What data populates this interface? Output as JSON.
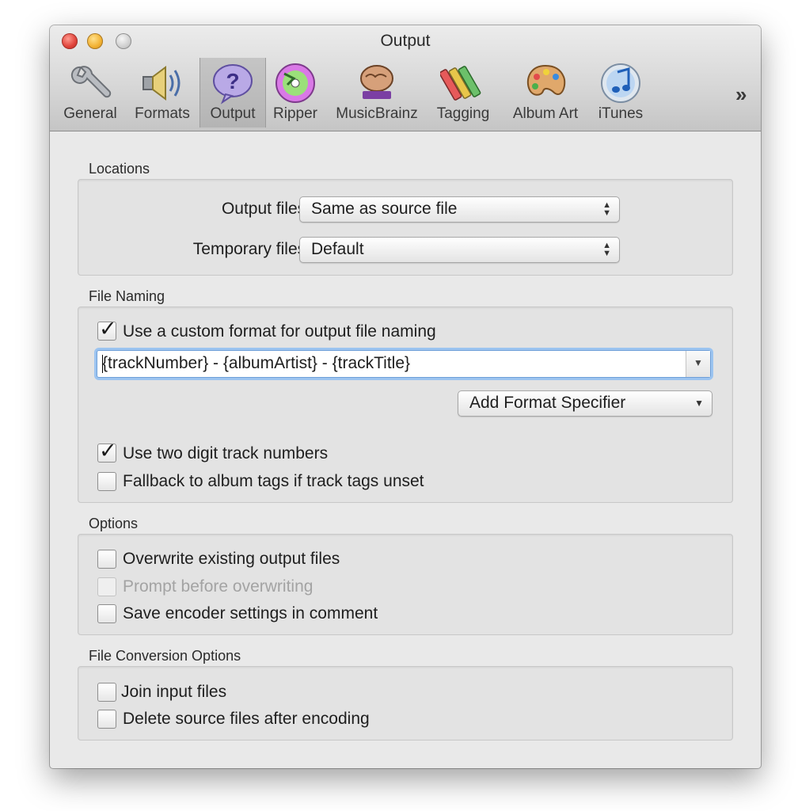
{
  "window": {
    "title": "Output"
  },
  "toolbar": {
    "items": [
      {
        "label": "General",
        "icon": "wrench-icon"
      },
      {
        "label": "Formats",
        "icon": "speaker-icon"
      },
      {
        "label": "Output",
        "icon": "question-bubble-icon",
        "selected": true
      },
      {
        "label": "Ripper",
        "icon": "cd-icon"
      },
      {
        "label": "MusicBrainz",
        "icon": "musicbrainz-brain-icon"
      },
      {
        "label": "Tagging",
        "icon": "crayons-icon"
      },
      {
        "label": "Album Art",
        "icon": "palette-icon"
      },
      {
        "label": "iTunes",
        "icon": "itunes-icon"
      }
    ],
    "overflow": "»"
  },
  "locations": {
    "section_label": "Locations",
    "output_files_label": "Output files:",
    "output_files_value": "Same as source file",
    "temporary_files_label": "Temporary files:",
    "temporary_files_value": "Default"
  },
  "file_naming": {
    "section_label": "File Naming",
    "custom_format_label": "Use a custom format for output file naming",
    "custom_format_checked": true,
    "format_value": "{trackNumber} - {albumArtist} - {trackTitle}",
    "add_specifier_label": "Add Format Specifier",
    "two_digit_label": "Use two digit track numbers",
    "two_digit_checked": true,
    "fallback_label": "Fallback to album tags if track tags unset",
    "fallback_checked": false
  },
  "options": {
    "section_label": "Options",
    "overwrite_label": "Overwrite existing output files",
    "prompt_label": "Prompt before overwriting",
    "save_encoder_label": "Save encoder settings in comment"
  },
  "conversion": {
    "section_label": "File Conversion Options",
    "join_label": "Join input files",
    "delete_label": "Delete source files after encoding"
  },
  "colors": {
    "window_bg": "#e9e9e9",
    "focus_ring": "#9cc4f0",
    "selected_tab": "#b9b9b9"
  }
}
